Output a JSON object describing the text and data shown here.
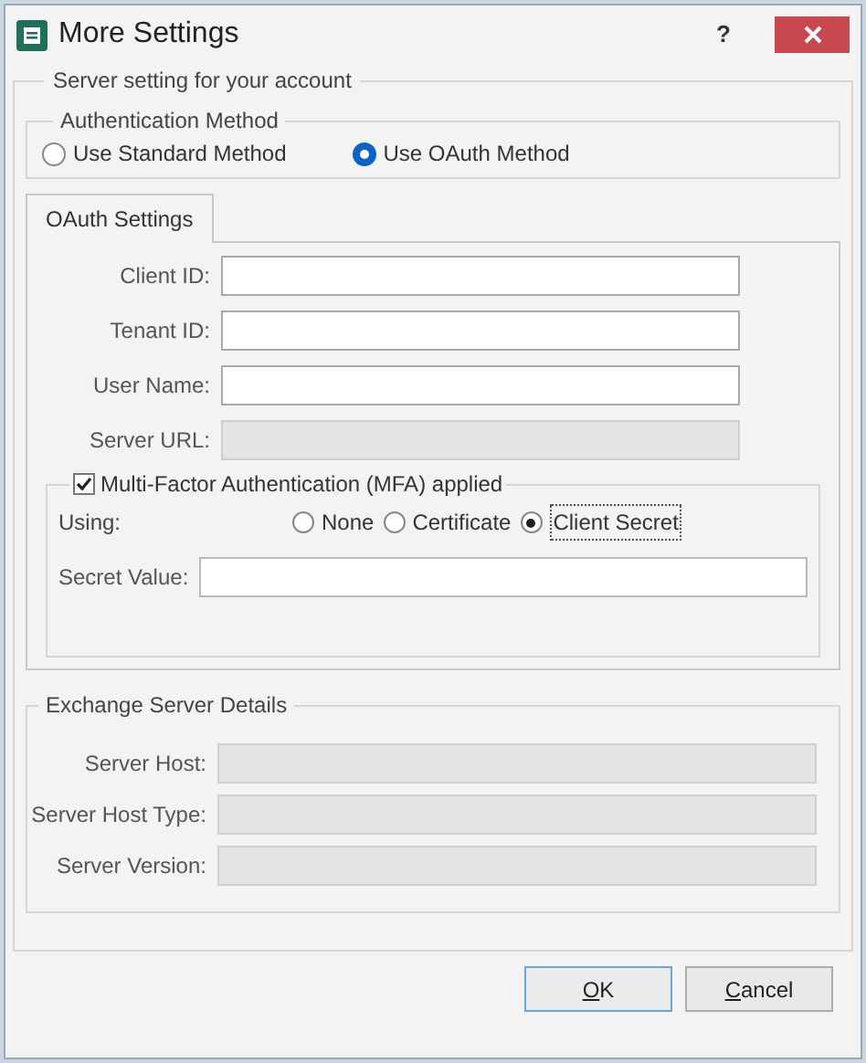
{
  "window": {
    "title": "More Settings",
    "help": "?"
  },
  "server_group": {
    "title": "Server setting for your account"
  },
  "auth_method": {
    "title": "Authentication Method",
    "options": [
      {
        "label": "Use Standard Method",
        "selected": false
      },
      {
        "label": "Use OAuth Method",
        "selected": true
      }
    ]
  },
  "tabs": [
    {
      "label": "OAuth Settings",
      "selected": true
    }
  ],
  "oauth_fields": [
    {
      "label": "Client ID:",
      "disabled": false
    },
    {
      "label": "Tenant ID:",
      "disabled": false
    },
    {
      "label": "User Name:",
      "disabled": false
    },
    {
      "label": "Server URL:",
      "disabled": true
    }
  ],
  "mfa": {
    "label": "Multi-Factor Authentication (MFA) applied",
    "checked": true,
    "using_label": "Using:",
    "options": [
      {
        "label": "None",
        "selected": false
      },
      {
        "label": "Certificate",
        "selected": false
      },
      {
        "label": "Client Secret",
        "selected": true
      }
    ],
    "secret_label": "Secret Value:"
  },
  "exchange": {
    "title": "Exchange Server Details",
    "fields": [
      {
        "label": "Server Host:",
        "disabled": true
      },
      {
        "label": "Server Host Type:",
        "disabled": true
      },
      {
        "label": "Server Version:",
        "disabled": true
      }
    ]
  },
  "buttons": [
    {
      "label": "OK",
      "default": true,
      "mnemonic": true
    },
    {
      "label": "Cancel",
      "default": false,
      "mnemonic": true
    }
  ]
}
